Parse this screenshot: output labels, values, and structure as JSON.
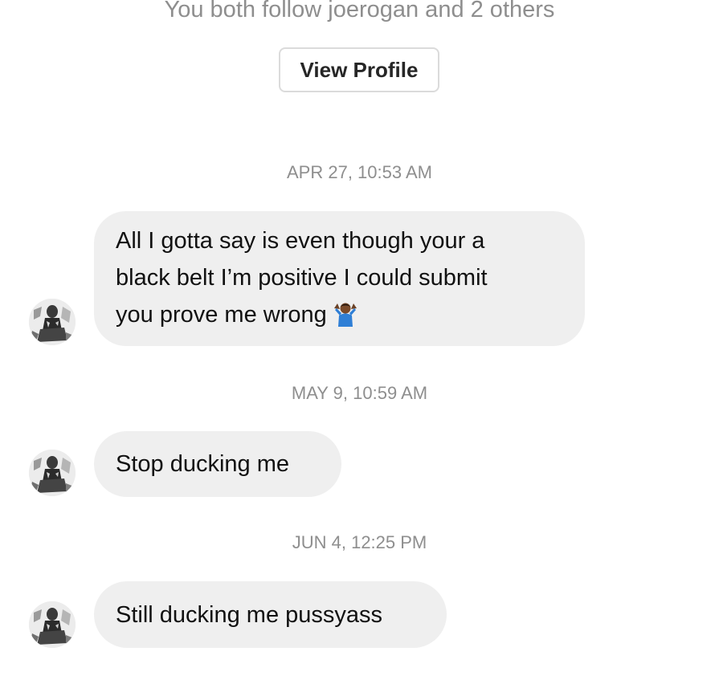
{
  "header": {
    "mutual_followers": "You both follow joerogan and 2 others",
    "view_profile_label": "View Profile"
  },
  "thread": {
    "messages": [
      {
        "timestamp": "APR 27, 10:53 AM",
        "lines": [
          "All I gotta say is even though your a",
          "black belt I’m positive I could submit",
          "you prove me wrong"
        ],
        "emoji": "person-shrugging-icon"
      },
      {
        "timestamp": "MAY 9, 10:59 AM",
        "text": "Stop ducking me"
      },
      {
        "timestamp": "JUN 4, 12:25 PM",
        "text": "Still ducking me pussyass"
      }
    ]
  },
  "colors": {
    "background": "#ffffff",
    "bubble": "#efefef",
    "muted_text": "#8e8e8e",
    "button_border": "#dbdbdb",
    "text": "#111111"
  }
}
